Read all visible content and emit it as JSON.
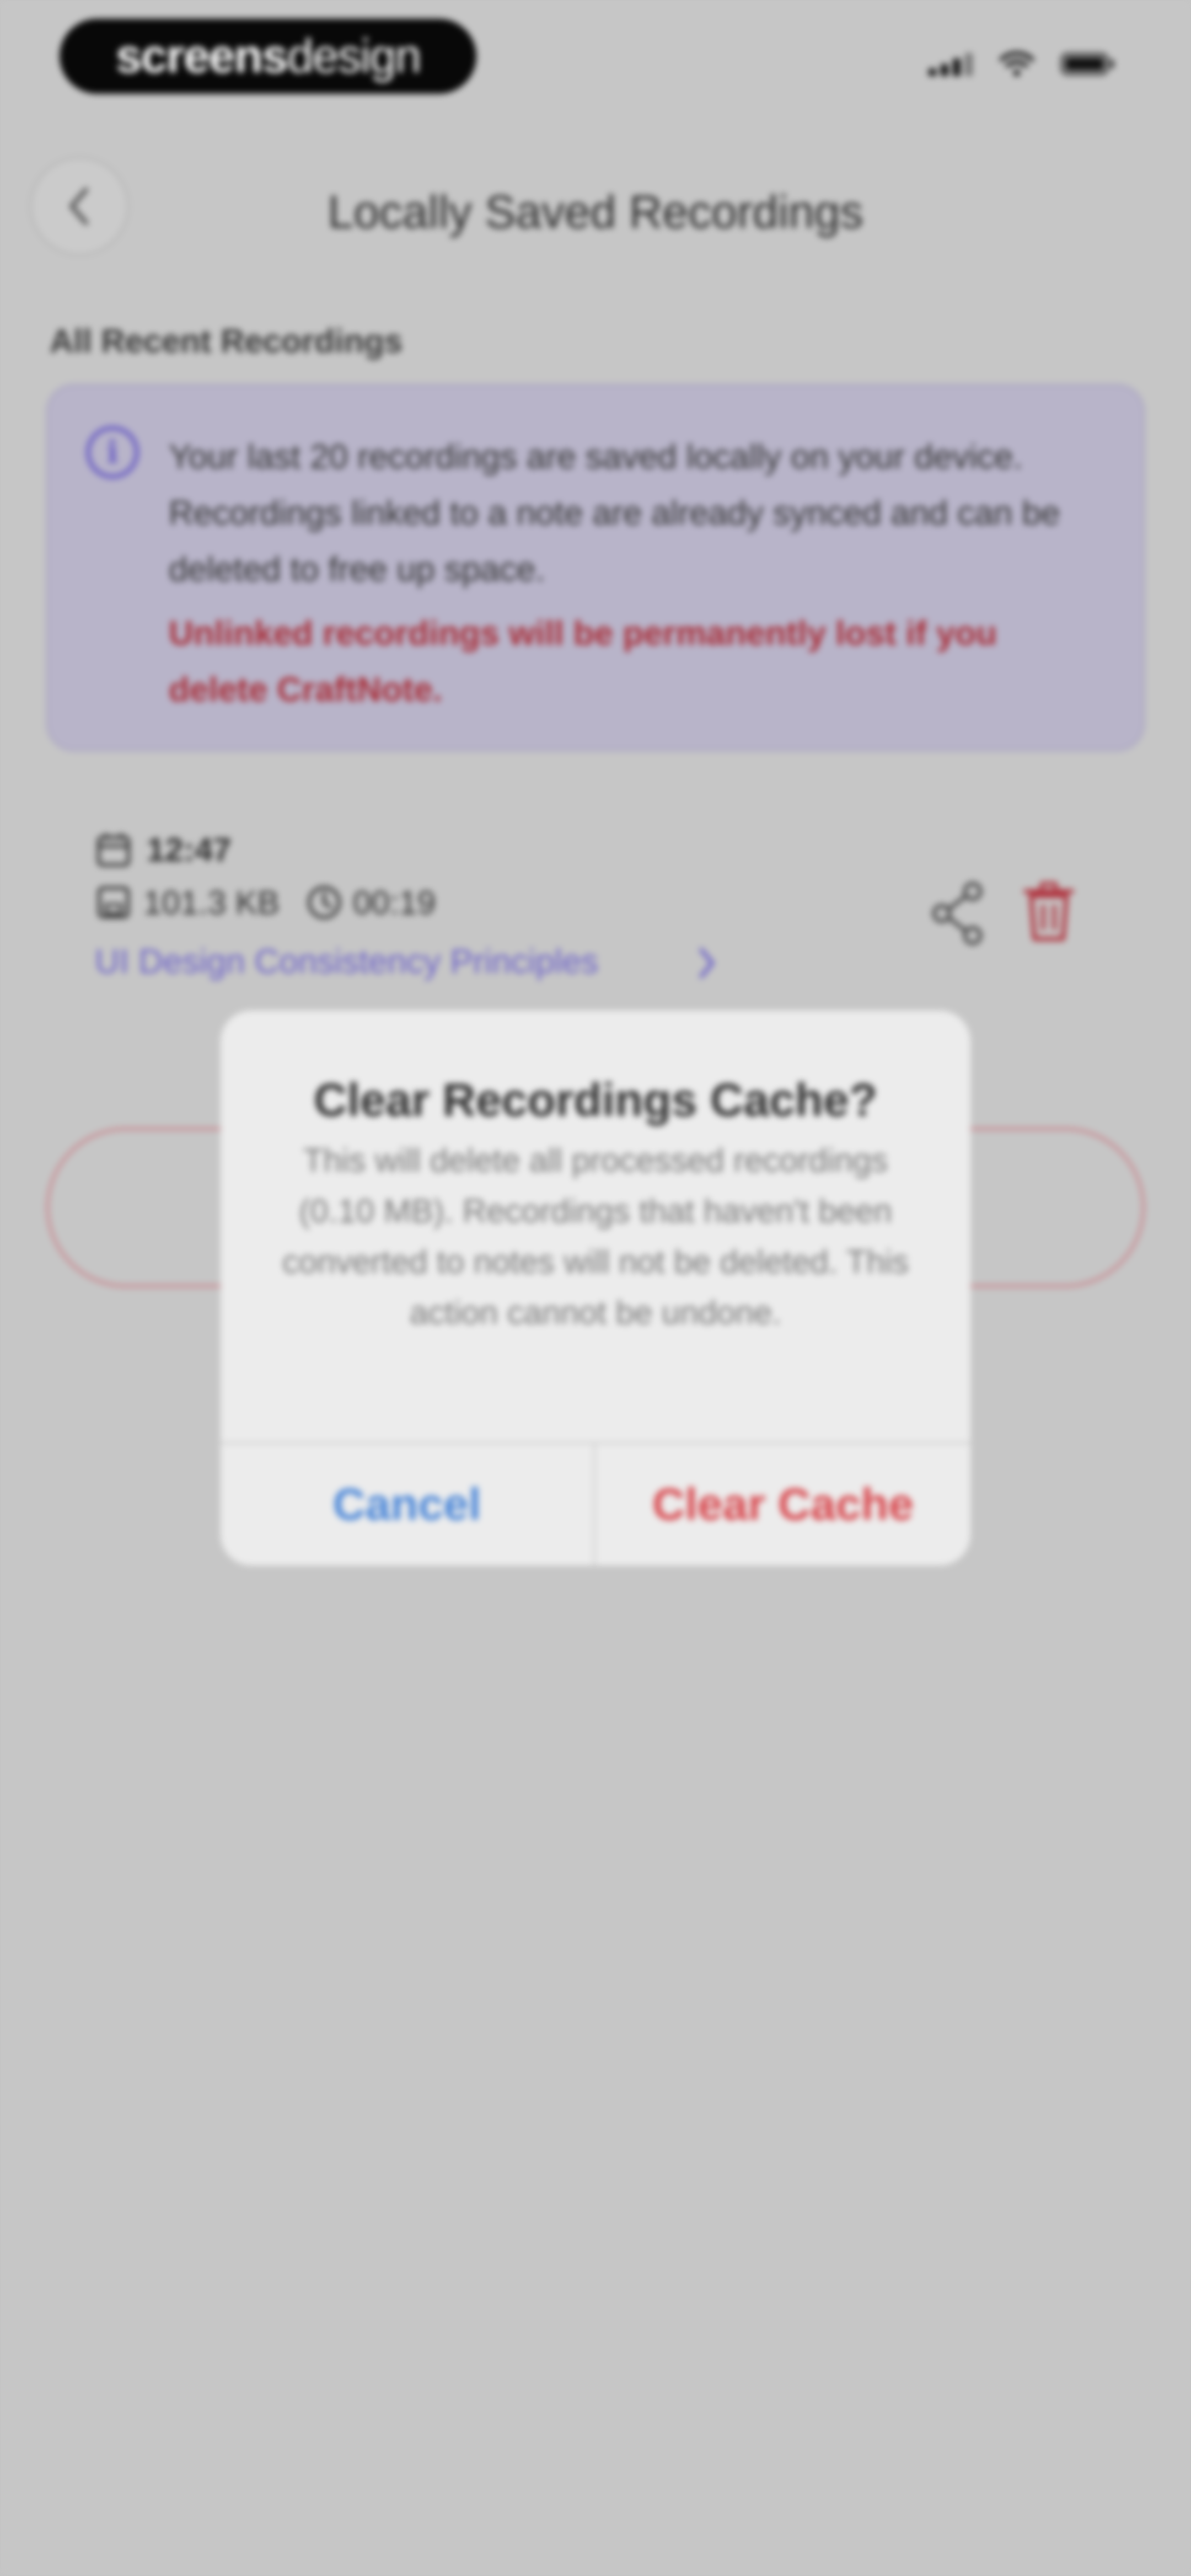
{
  "status_bar": {
    "watermark_bold": "screens",
    "watermark_light": "design"
  },
  "header": {
    "back_icon": "chevron-left-icon",
    "title": "Locally Saved Recordings"
  },
  "section": {
    "label": "All Recent Recordings"
  },
  "info_card": {
    "icon": "info-icon",
    "icon_glyph": "i",
    "text": "Your last 20 recordings are saved locally on your device. Recordings linked to a note are already synced and can be deleted to free up space.",
    "warning": "Unlinked recordings will be permanently lost if you delete CraftNote.",
    "warning_color": "#a82d38",
    "accent_color": "#6c60c4"
  },
  "recordings": [
    {
      "time": "12:47",
      "size": "101.3 KB",
      "duration": "00:19",
      "linked_note": "UI Design Consistency Principles"
    }
  ],
  "dialog": {
    "title": "Clear Recordings Cache?",
    "message": "This will delete all processed recordings (0.10 MB). Recordings that haven't been converted to notes will not be deleted. This action cannot be undone.",
    "cancel_label": "Cancel",
    "confirm_label": "Clear Cache",
    "cancel_color": "#4a86d8",
    "confirm_color": "#d8474d"
  }
}
